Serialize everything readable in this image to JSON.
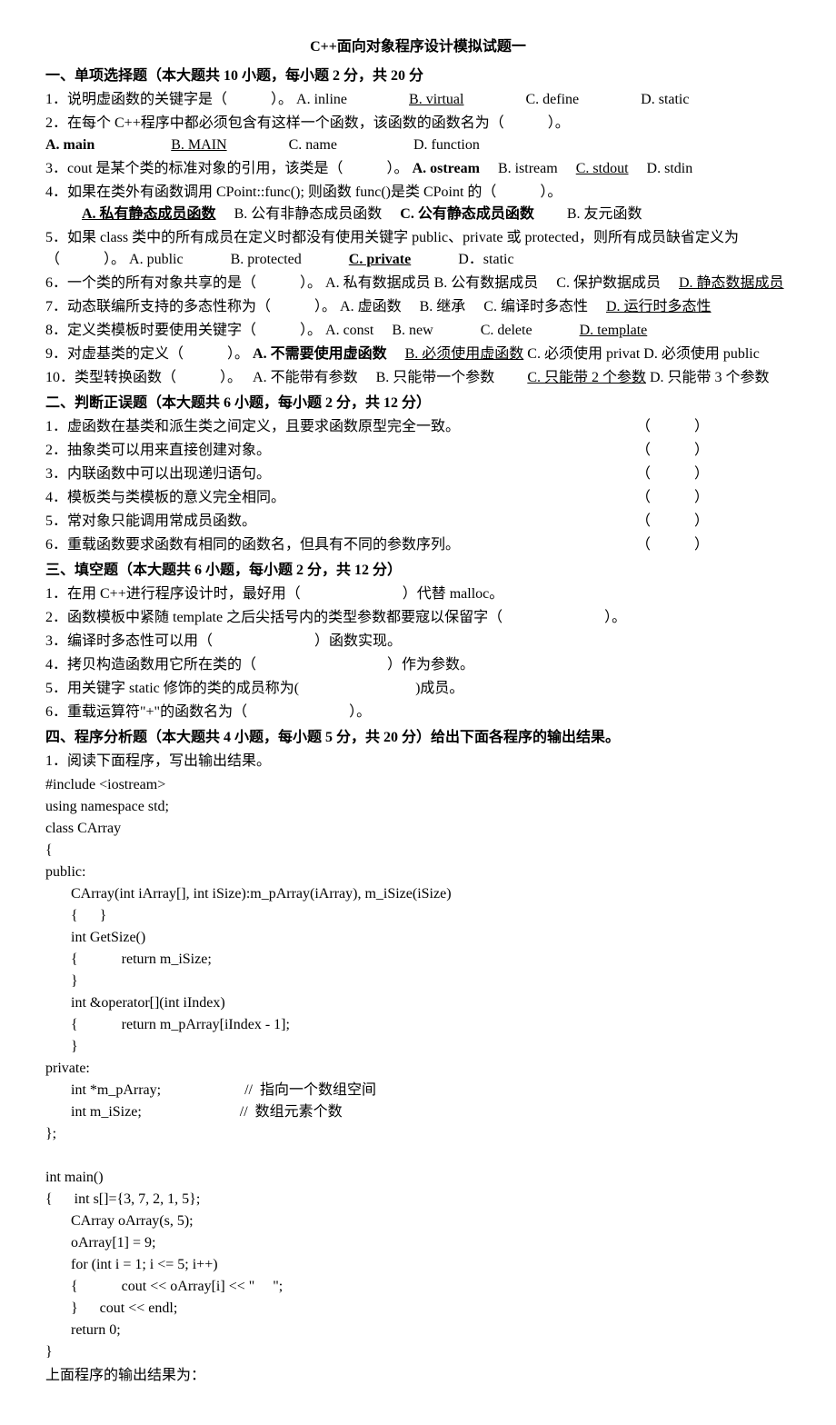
{
  "title": "C++面向对象程序设计模拟试题一",
  "section1": {
    "header": "一、单项选择题（本大题共 10 小题，每小题 2 分，共 20 分",
    "q1": {
      "text": "1．说明虚函数的关键字是（　　　）。",
      "a": "A. inline",
      "b": "B. virtual",
      "c": "C. define",
      "d": "D. static"
    },
    "q2": {
      "text": "2．在每个 C++程序中都必须包含有这样一个函数，该函数的函数名为（　　　）。",
      "a": "A. main",
      "b": "B. MAIN",
      "c": "C. name",
      "d": "D. function"
    },
    "q3": {
      "text": "3．cout 是某个类的标准对象的引用，该类是（　　　）。",
      "a": "A. ostream",
      "b": "B. istream",
      "c": "C. stdout",
      "d": "D. stdin"
    },
    "q4": {
      "text": "4．如果在类外有函数调用 CPoint::func(); 则函数 func()是类 CPoint 的（　　　）。",
      "a": "A. 私有静态成员函数",
      "b": "B. 公有非静态成员函数",
      "c": "C. 公有静态成员函数",
      "d": "B. 友元函数"
    },
    "q5": {
      "text": "5．如果 class 类中的所有成员在定义时都没有使用关键字 public、private 或 protected，则所有成员缺省定义为（　　　）。",
      "a": "A. public",
      "b": "B. protected",
      "c": "C. private",
      "d": "D．static"
    },
    "q6": {
      "text": "6．一个类的所有对象共享的是（　　　）。",
      "a": "A. 私有数据成员",
      "b": "B. 公有数据成员",
      "c": "C. 保护数据成员",
      "d": "D. 静态数据成员"
    },
    "q7": {
      "text": "7．动态联编所支持的多态性称为（　　　）。",
      "a": "A. 虚函数",
      "b": "B. 继承",
      "c": "C. 编译时多态性",
      "d": "D. 运行时多态性"
    },
    "q8": {
      "text": "8．定义类模板时要使用关键字（　　　）。",
      "a": "A. const",
      "b": "B. new",
      "c": "C. delete",
      "d": "D. template"
    },
    "q9": {
      "text": "9．对虚基类的定义（　　　）。",
      "a": "A. 不需要使用虚函数",
      "b": "B. 必须使用虚函数",
      "c": "C. 必须使用 privat",
      "d": "D. 必须使用 public"
    },
    "q10": {
      "text": "10．类型转换函数（　　　）。",
      "a": "A. 不能带有参数",
      "b": "B. 只能带一个参数",
      "c": "C. 只能带 2 个参数",
      "d": "D. 只能带 3 个参数"
    }
  },
  "section2": {
    "header": "二、判断正误题（本大题共 6 小题，每小题 2 分，共 12 分）",
    "q1": "1．虚函数在基类和派生类之间定义，且要求函数原型完全一致。",
    "q2": "2．抽象类可以用来直接创建对象。",
    "q3": "3．内联函数中可以出现递归语句。",
    "q4": "4．模板类与类模板的意义完全相同。",
    "q5": "5．常对象只能调用常成员函数。",
    "q6": "6．重载函数要求函数有相同的函数名，但具有不同的参数序列。",
    "bracket": "（　　　）"
  },
  "section3": {
    "header": "三、填空题（本大题共 6 小题，每小题 2 分，共 12 分）",
    "q1": "1．在用 C++进行程序设计时，最好用（　　　　　　　）代替 malloc。",
    "q2": "2．函数模板中紧随 template 之后尖括号内的类型参数都要寇以保留字（　　　　　　　）。",
    "q3": "3．编译时多态性可以用（　　　　　　　）函数实现。",
    "q4": "4．拷贝构造函数用它所在类的（　　　　　　　　　）作为参数。",
    "q5": "5．用关键字 static 修饰的类的成员称为(　　　　　　　　)成员。",
    "q6": "6．重载运算符\"+\"的函数名为（　　　　　　　）。"
  },
  "section4": {
    "header": "四、程序分析题（本大题共 4 小题，每小题 5 分，共 20 分）给出下面各程序的输出结果。",
    "q1_intro": "1．阅读下面程序，写出输出结果。",
    "code": "#include <iostream>\nusing namespace std;\nclass CArray\n{\npublic:\n       CArray(int iArray[], int iSize):m_pArray(iArray), m_iSize(iSize)\n       {      }\n       int GetSize()\n       {            return m_iSize;\n       }\n       int &operator[](int iIndex)\n       {            return m_pArray[iIndex - 1];\n       }\nprivate:\n       int *m_pArray;                       //  指向一个数组空间\n       int m_iSize;                           //  数组元素个数\n};\n\nint main()\n{      int s[]={3, 7, 2, 1, 5};\n       CArray oArray(s, 5);\n       oArray[1] = 9;\n       for (int i = 1; i <= 5; i++)\n       {            cout << oArray[i] << \"     \";\n       }      cout << endl;\n       return 0;\n}",
    "q1_outro": "上面程序的输出结果为："
  }
}
